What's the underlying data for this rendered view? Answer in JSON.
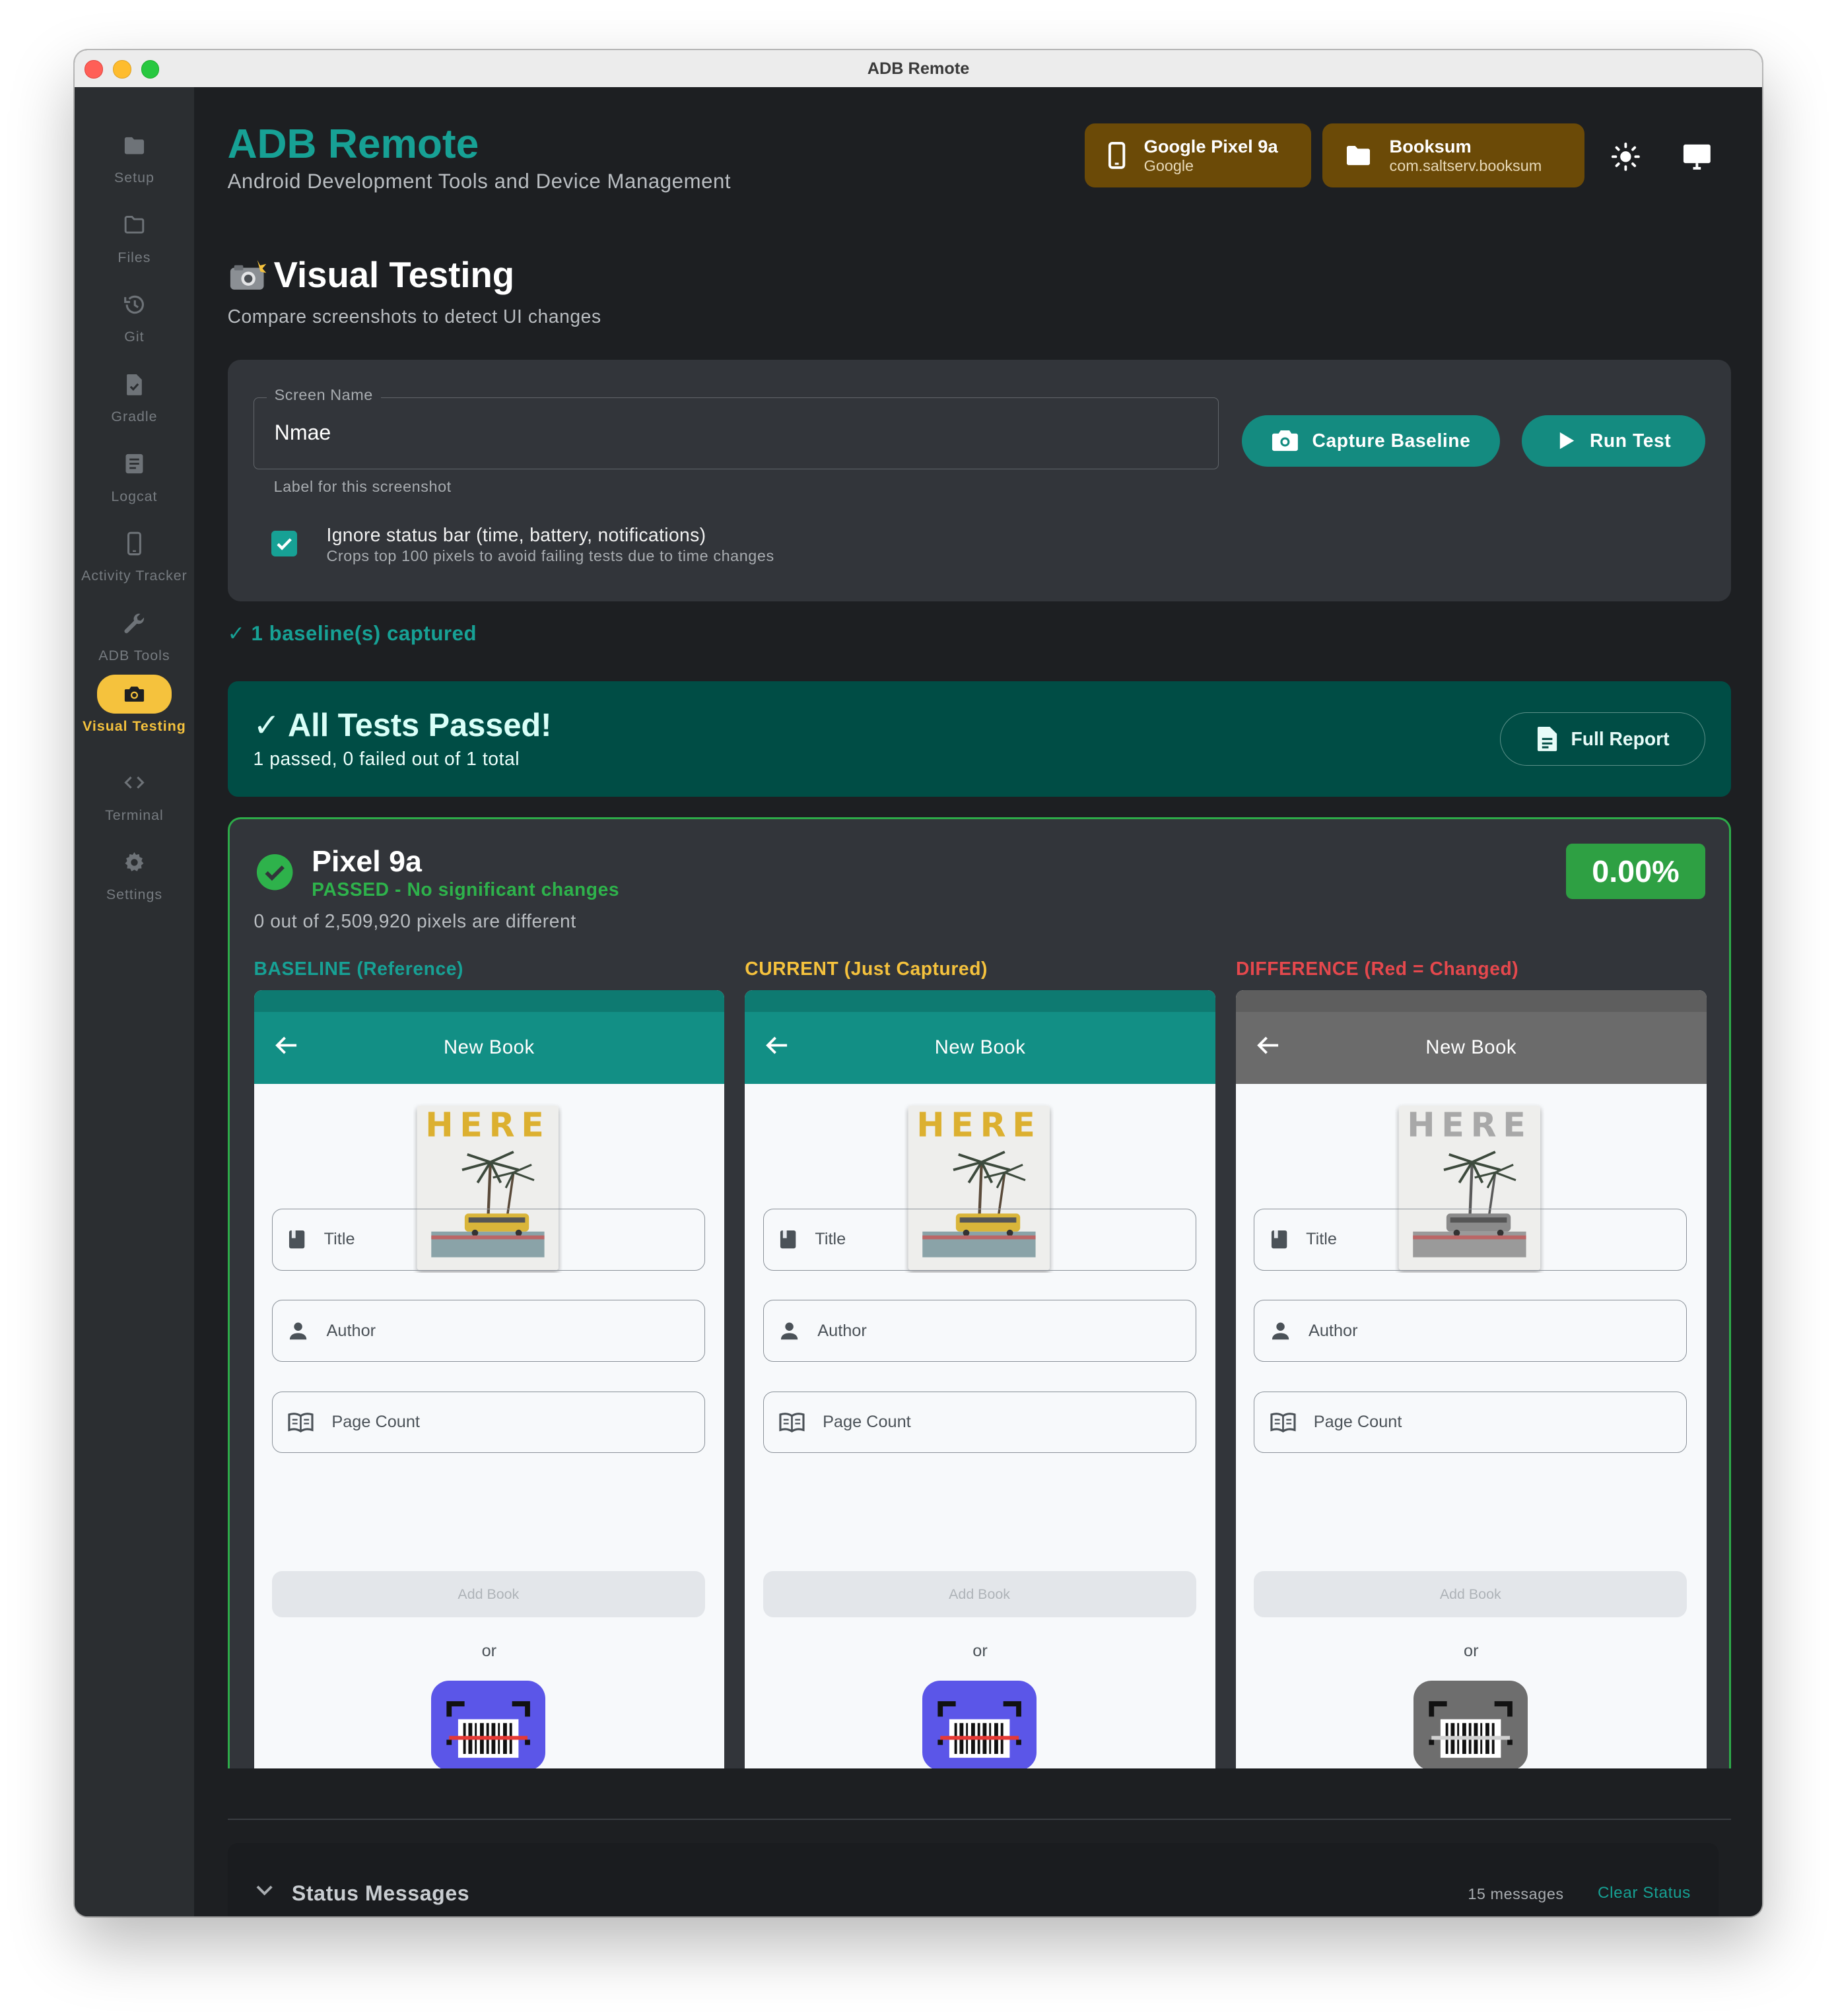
{
  "window": {
    "title": "ADB Remote"
  },
  "sidebar": {
    "items": [
      {
        "label": "Setup",
        "icon": "folder-filled-icon",
        "active": false
      },
      {
        "label": "Files",
        "icon": "folder-outline-icon",
        "active": false
      },
      {
        "label": "Git",
        "icon": "history-icon",
        "active": false
      },
      {
        "label": "Gradle",
        "icon": "file-check-icon",
        "active": false
      },
      {
        "label": "Logcat",
        "icon": "list-doc-icon",
        "active": false
      },
      {
        "label": "Activity Tracker",
        "icon": "phone-icon",
        "active": false
      },
      {
        "label": "ADB Tools",
        "icon": "wrench-icon",
        "active": false
      },
      {
        "label": "Visual Testing",
        "icon": "camera-icon",
        "active": true
      },
      {
        "label": "Terminal",
        "icon": "code-icon",
        "active": false
      },
      {
        "label": "Settings",
        "icon": "gear-icon",
        "active": false
      }
    ]
  },
  "header": {
    "title": "ADB Remote",
    "subtitle": "Android Development Tools and Device Management",
    "device": {
      "name": "Google Pixel 9a",
      "vendor": "Google"
    },
    "project": {
      "name": "Booksum",
      "package": "com.saltserv.booksum"
    }
  },
  "page": {
    "emoji": "📸",
    "title": "Visual Testing",
    "subtitle": "Compare screenshots to detect UI changes"
  },
  "form": {
    "field_label": "Screen Name",
    "field_value": "Nmae",
    "field_helper": "Label for this screenshot",
    "capture_button": "Capture Baseline",
    "run_button": "Run Test",
    "checkbox_checked": true,
    "checkbox_label": "Ignore status bar (time, battery, notifications)",
    "checkbox_sub": "Crops top 100 pixels to avoid failing tests due to time changes"
  },
  "baseline_status": "✓ 1 baseline(s) captured",
  "summary": {
    "title": "✓ All Tests Passed!",
    "subtitle": "1 passed, 0 failed out of 1 total",
    "report_button": "Full Report"
  },
  "result": {
    "device": "Pixel 9a",
    "status": "PASSED - No significant changes",
    "pixels_text": "0 out of 2,509,920 pixels are different",
    "diff_percent": "0.00%"
  },
  "columns": [
    {
      "label": "BASELINE (Reference)",
      "color": "#17a195",
      "appbar_color": "#128f85",
      "statusbar_color": "#0e7a71",
      "grayscale": false
    },
    {
      "label": "CURRENT (Just Captured)",
      "color": "#f5c23d",
      "appbar_color": "#128f85",
      "statusbar_color": "#0e7a71",
      "grayscale": false
    },
    {
      "label": "DIFFERENCE (Red = Changed)",
      "color": "#e5484d",
      "appbar_color": "#6b6b6b",
      "statusbar_color": "#5e5e5e",
      "grayscale": true
    }
  ],
  "screenshot": {
    "appbar_title": "New Book",
    "cover_text": "HERE",
    "fields": [
      "Title",
      "Author",
      "Page Count"
    ],
    "add_button": "Add Book",
    "or_text": "or"
  },
  "status_panel": {
    "title": "Status Messages",
    "count": "15 messages",
    "clear_label": "Clear Status"
  },
  "colors": {
    "accent": "#17a195",
    "warning_chip": "#6b4a07",
    "success": "#2ea043",
    "sidebar_active": "#f5c23d"
  }
}
